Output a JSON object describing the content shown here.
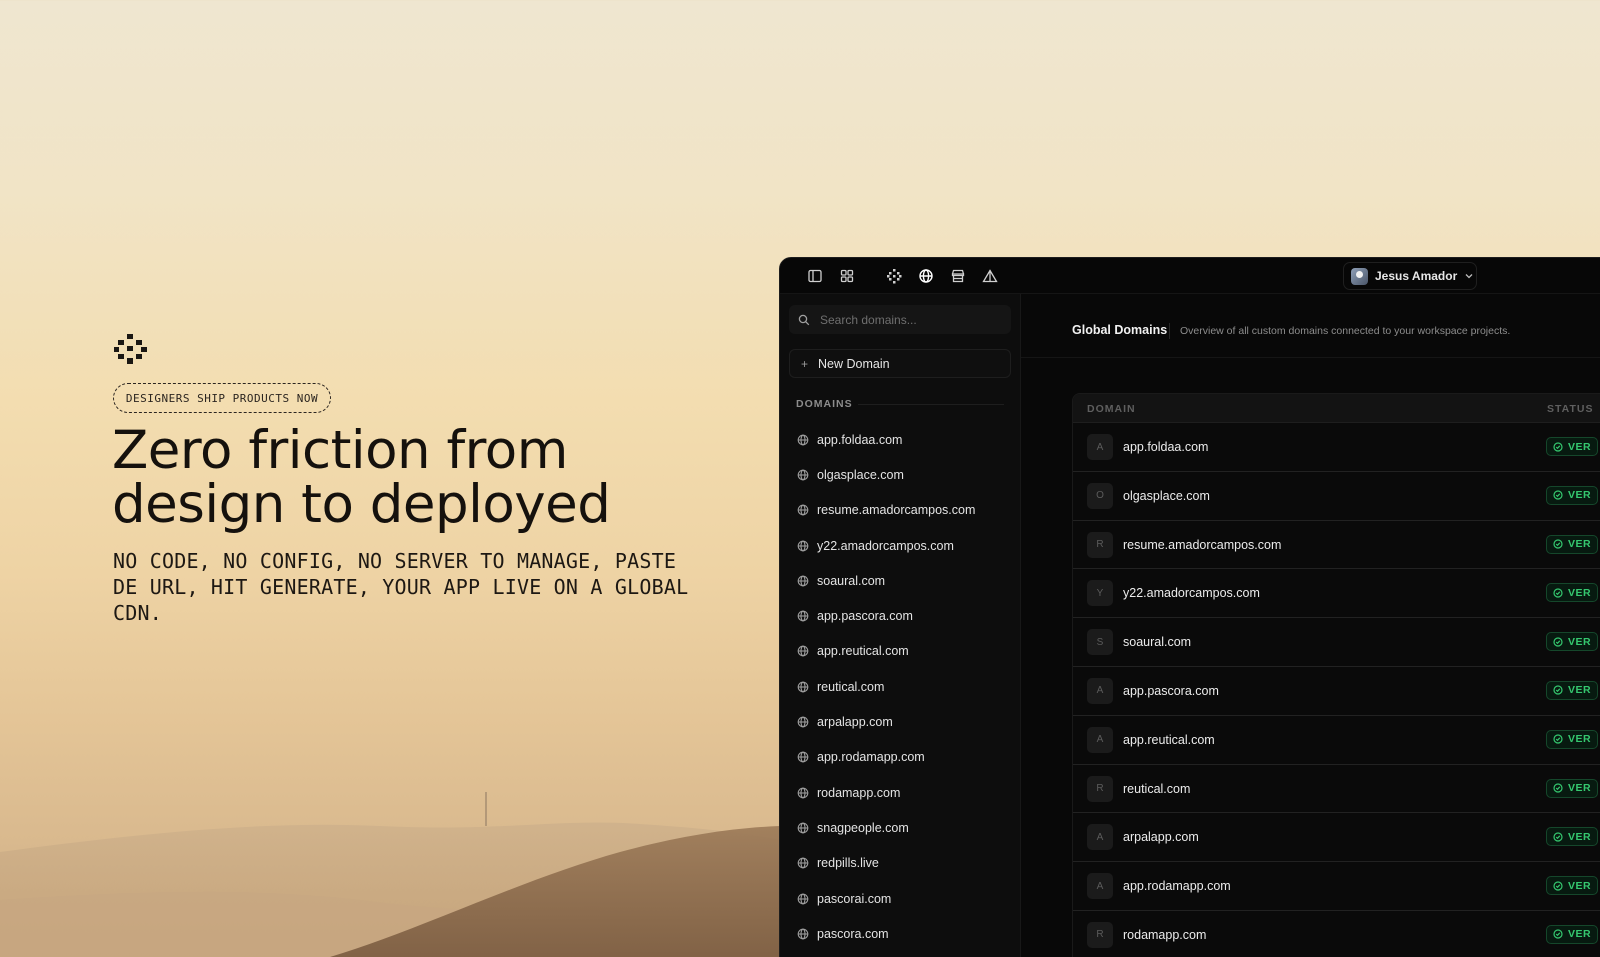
{
  "hero": {
    "badge": "DESIGNERS SHIP PRODUCTS NOW",
    "title_line1": "Zero friction from",
    "title_line2": "design to deployed",
    "subtitle": "NO CODE, NO CONFIG, NO SERVER TO MANAGE, PASTE DE URL, HIT GENERATE, YOUR APP LIVE ON A GLOBAL CDN."
  },
  "toolbar": {
    "icons": [
      "sidebar-toggle-icon",
      "grid-icon",
      "dots-logo-icon",
      "globe-icon",
      "store-icon",
      "triangle-icon"
    ]
  },
  "user": {
    "name": "Jesus Amador"
  },
  "sidebar": {
    "search_placeholder": "Search domains...",
    "new_domain_label": "New Domain",
    "section_label": "DOMAINS",
    "domains": [
      "app.foldaa.com",
      "olgasplace.com",
      "resume.amadorcampos.com",
      "y22.amadorcampos.com",
      "soaural.com",
      "app.pascora.com",
      "app.reutical.com",
      "reutical.com",
      "arpalapp.com",
      "app.rodamapp.com",
      "rodamapp.com",
      "snagpeople.com",
      "redpills.live",
      "pascorai.com",
      "pascora.com"
    ]
  },
  "main": {
    "title": "Global Domains",
    "description": "Overview of all custom domains connected to your workspace projects.",
    "columns": {
      "domain": "DOMAIN",
      "status": "STATUS"
    },
    "rows": [
      {
        "letter": "A",
        "domain": "app.foldaa.com",
        "status": "VER"
      },
      {
        "letter": "O",
        "domain": "olgasplace.com",
        "status": "VER"
      },
      {
        "letter": "R",
        "domain": "resume.amadorcampos.com",
        "status": "VER"
      },
      {
        "letter": "Y",
        "domain": "y22.amadorcampos.com",
        "status": "VER"
      },
      {
        "letter": "S",
        "domain": "soaural.com",
        "status": "VER"
      },
      {
        "letter": "A",
        "domain": "app.pascora.com",
        "status": "VER"
      },
      {
        "letter": "A",
        "domain": "app.reutical.com",
        "status": "VER"
      },
      {
        "letter": "R",
        "domain": "reutical.com",
        "status": "VER"
      },
      {
        "letter": "A",
        "domain": "arpalapp.com",
        "status": "VER"
      },
      {
        "letter": "A",
        "domain": "app.rodamapp.com",
        "status": "VER"
      },
      {
        "letter": "R",
        "domain": "rodamapp.com",
        "status": "VER"
      }
    ]
  },
  "colors": {
    "status_green": "#35c86f",
    "app_bg": "#0b0b0b",
    "hero_text": "#15110d"
  }
}
